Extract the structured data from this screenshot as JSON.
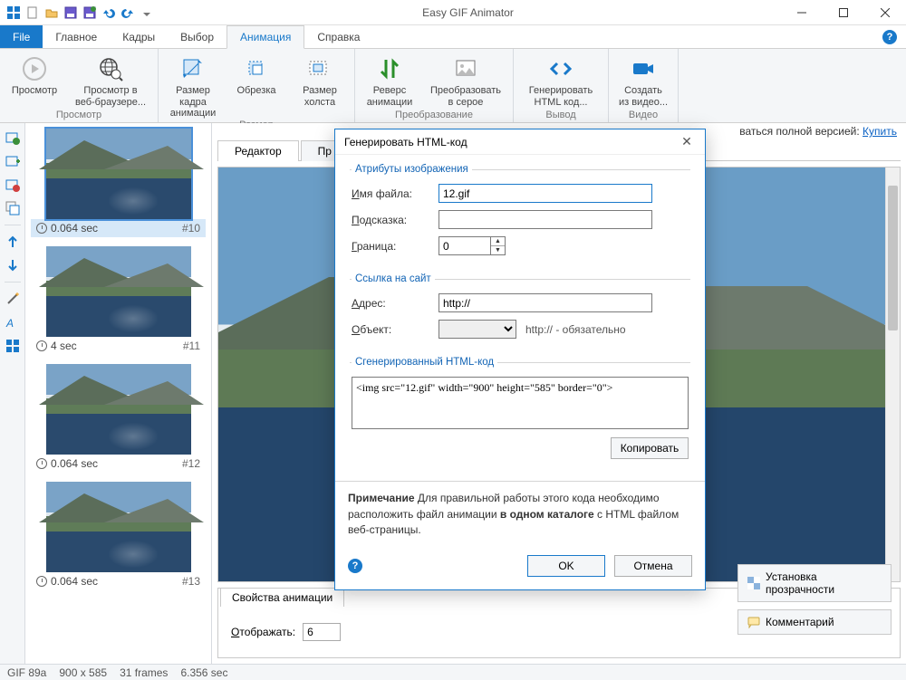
{
  "app": {
    "title": "Easy GIF Animator"
  },
  "qat_icons": [
    "grid-icon",
    "new-icon",
    "open-icon",
    "save-icon",
    "saveas-icon",
    "undo-icon",
    "redo-icon",
    "dropdown-icon"
  ],
  "menu": {
    "file": "File",
    "tabs": [
      "Главное",
      "Кадры",
      "Выбор",
      "Анимация",
      "Справка"
    ],
    "active": 3
  },
  "ribbon": {
    "groups": [
      {
        "label": "Просмотр",
        "buttons": [
          {
            "name": "play",
            "label": "Просмотр",
            "icon": "play-circle"
          },
          {
            "name": "browser",
            "label": "Просмотр в\nвеб-браузере...",
            "icon": "globe-magnify",
            "wide": true
          }
        ]
      },
      {
        "label": "Размер",
        "buttons": [
          {
            "name": "framesize",
            "label": "Размер кадра\nанимации",
            "icon": "resize-frame"
          },
          {
            "name": "crop",
            "label": "Обрезка",
            "icon": "crop"
          },
          {
            "name": "canvassize",
            "label": "Размер\nхолста",
            "icon": "canvas-resize"
          }
        ]
      },
      {
        "label": "Преобразование",
        "buttons": [
          {
            "name": "reverse",
            "label": "Реверс\nанимации",
            "icon": "reverse"
          },
          {
            "name": "grayscale",
            "label": "Преобразовать\nв серое",
            "icon": "image-gray",
            "wide": true
          }
        ]
      },
      {
        "label": "Вывод",
        "buttons": [
          {
            "name": "genhtml",
            "label": "Генерировать\nHTML код...",
            "icon": "code",
            "wide": true
          }
        ]
      },
      {
        "label": "Видео",
        "buttons": [
          {
            "name": "fromvideo",
            "label": "Создать\nиз видео...",
            "icon": "video"
          }
        ]
      }
    ]
  },
  "trial": {
    "prefix": "ваться полной версией: ",
    "link": "Купить"
  },
  "editorTabs": {
    "tabs": [
      "Редактор",
      "Пр"
    ],
    "active": 0
  },
  "frames": [
    {
      "delay": "0.064 sec",
      "num": "#10",
      "sel": true
    },
    {
      "delay": "4 sec",
      "num": "#11"
    },
    {
      "delay": "0.064 sec",
      "num": "#12"
    },
    {
      "delay": "0.064 sec",
      "num": "#13"
    }
  ],
  "props": {
    "tab": "Свойства анимации",
    "displayLabel": "Отображать:",
    "displayValue": "6"
  },
  "rightButtons": {
    "transparency": "Установка прозрачности",
    "comment": "Комментарий"
  },
  "dialog": {
    "title": "Генерировать HTML-код",
    "g1": "Атрибуты изображения",
    "g2": "Ссылка на сайт",
    "g3": "Сгенерированный HTML-код",
    "filenameLabel": "Имя файла:",
    "filenameUL": "И",
    "filenameValue": "12.gif",
    "hintLabel": "Подсказка:",
    "hintUL": "П",
    "hintValue": "",
    "borderLabel": "Граница:",
    "borderUL": "Г",
    "borderValue": "0",
    "addrLabel": "Адрес:",
    "addrUL": "А",
    "addrValue": "http://",
    "objLabel": "Объект:",
    "objUL": "О",
    "objHint": "http://  -  обязательно",
    "codeValue": "<img src=\"12.gif\" width=\"900\" height=\"585\" border=\"0\">",
    "copy": "Копировать",
    "note": "Примечание",
    "noteBody1": " Для правильной работы этого кода необходимо расположить файл анимации ",
    "noteBold": "в одном каталоге",
    "noteBody2": " с HTML файлом веб-страницы.",
    "ok": "OK",
    "cancel": "Отмена"
  },
  "status": {
    "format": "GIF 89a",
    "dims": "900 x 585",
    "frames": "31 frames",
    "dur": "6.356 sec"
  }
}
